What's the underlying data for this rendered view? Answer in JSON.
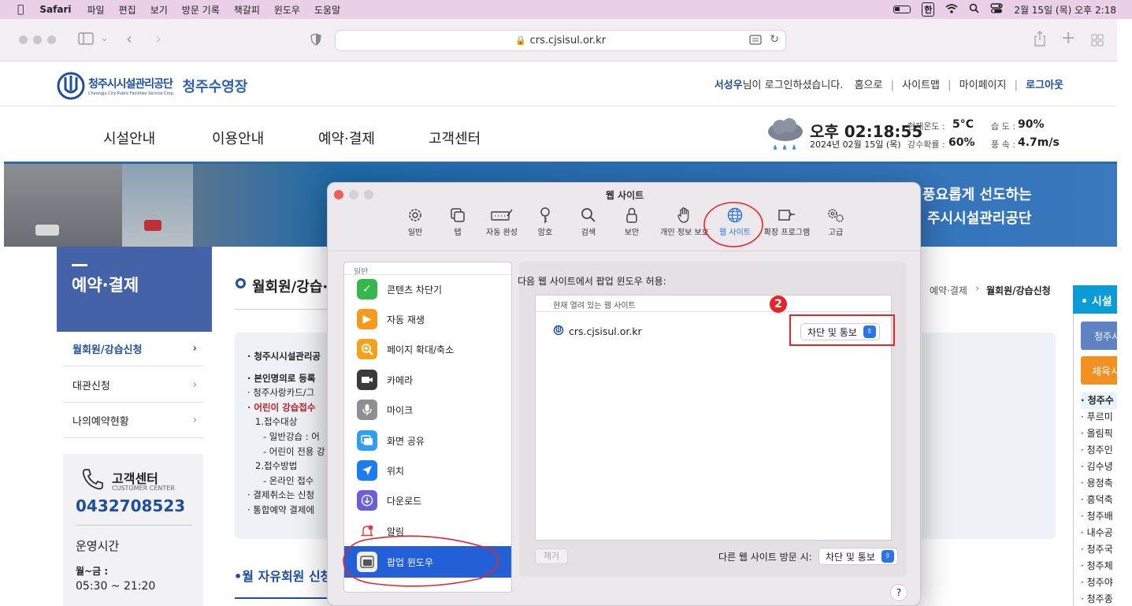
{
  "menubar": {
    "app": "Safari",
    "items": [
      "파일",
      "편집",
      "보기",
      "방문 기록",
      "책갈피",
      "윈도우",
      "도움말"
    ],
    "ime": "한",
    "datetime": "2월 15일 (목) 오후 2:18"
  },
  "browser": {
    "url": "crs.cjsisul.or.kr"
  },
  "site": {
    "logo_text": "청주시시설관리공단",
    "logo_sub": "Cheongju City Public Facilities Service Corp.",
    "site_name": "청주수영장",
    "user": "서성우",
    "login_msg": "님이 로그인하셨습니다.",
    "nav_links": [
      "홈으로",
      "사이트맵",
      "마이페이지",
      "로그아웃"
    ],
    "gnb": [
      "시설안내",
      "이용안내",
      "예약·결제",
      "고객센터"
    ],
    "weather": {
      "time": "오후 02:18:55",
      "date": "2024년 02월 15일 (목)",
      "temp_label": "현재온도 :",
      "temp": "5°C",
      "rain_label": "강수확률 :",
      "rain": "60%",
      "hum_label": "습 도 :",
      "hum": "90%",
      "wind_label": "풍 속 :",
      "wind": "4.7m/s"
    },
    "banner_text_1": "풍요롭게 선도하는",
    "banner_text_2": "주시시설관리공단",
    "lnb_title": "예약·결제",
    "lnb_items": [
      "월회원/강습신청",
      "대관신청",
      "나의예약현황"
    ],
    "cs_title": "고객센터",
    "cs_sub": "CUSTOMER CENTER",
    "cs_phone": "0432708523",
    "hours_title": "운영시간",
    "hours_days": "월~금 :",
    "hours_time": "05:30 ~ 21:20",
    "page_title": "월회원/강습·",
    "breadcrumb_1": "예약·결제",
    "breadcrumb_2": "월회원/강습신청",
    "notice_lines": [
      "· 청주시시설관리공",
      "· 본인명의로 등록",
      "· 청주사랑카드/그",
      "· 어린이 강습접수",
      "1.접수대상",
      "- 일반강습 : 어",
      "- 어린이 전용 강",
      "2.접수방법",
      "- 온라인 접수",
      "· 결제취소는 신청",
      "· 통합예약 결제에"
    ],
    "section2_title": "•월 자유회원 신청",
    "right_panel_title": "• 시설 ",
    "right_btn1": "청주시",
    "right_btn2": "체육시",
    "right_list": [
      "· 청주수",
      "· 푸르미",
      "· 올림픽",
      "· 청주인",
      "· 김수녕",
      "· 용정축",
      "· 흥덕축",
      "· 청주배",
      "· 내수공",
      "· 청주국",
      "· 청주체",
      "· 청주야",
      "· 청주종"
    ]
  },
  "dialog": {
    "title": "웹 사이트",
    "tabs": [
      "일반",
      "탭",
      "자동 완성",
      "암호",
      "검색",
      "보안",
      "개인 정보 보호",
      "웹 사이트",
      "확장 프로그램",
      "고급"
    ],
    "left_header": "일반",
    "left_items": [
      "콘텐츠 차단기",
      "자동 재생",
      "페이지 확대/축소",
      "카메라",
      "마이크",
      "화면 공유",
      "위치",
      "다운로드",
      "알림",
      "팝업 윈도우"
    ],
    "right_heading": "다음 웹 사이트에서 팝업 윈도우 허용:",
    "table_header": "현재 열려 있는 웹 사이트",
    "site_row": "crs.cjsisul.or.kr",
    "site_setting": "차단 및 통보",
    "annotation_num": "2",
    "remove_btn": "제거",
    "other_label": "다른 웹 사이트 방문 시:",
    "other_setting": "차단 및 통보",
    "help": "?"
  },
  "colors": {
    "accent": "#2a74e6",
    "annotation": "#e5252a",
    "lnb": "#4462a8",
    "site_blue": "#1f4f9c"
  }
}
